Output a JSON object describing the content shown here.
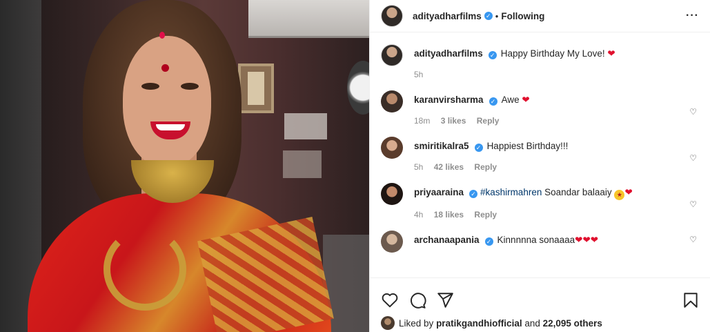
{
  "header": {
    "username": "adityadharfilms",
    "separator": "•",
    "follow_status": "Following",
    "more_icon": "more-horizontal-icon"
  },
  "caption": {
    "username": "adityadharfilms",
    "text": "Happy Birthday My Love!",
    "emoji": "❤",
    "time": "5h"
  },
  "comments": [
    {
      "username": "karanvirsharma",
      "text": "Awe",
      "emoji": "❤",
      "time": "18m",
      "likes": "3 likes",
      "reply": "Reply"
    },
    {
      "username": "smiritikalra5",
      "text": "Happiest Birthday!!!",
      "emoji": "",
      "time": "5h",
      "likes": "42 likes",
      "reply": "Reply"
    },
    {
      "username": "priyaaraina",
      "hashtag": "#kashirmahren",
      "text": "Soandar balaaiy",
      "emoji": "❤",
      "time": "4h",
      "likes": "18 likes",
      "reply": "Reply"
    },
    {
      "username": "archanaapania",
      "text": "Kinnnnna sonaaaa",
      "emoji": "❤❤❤",
      "time": "",
      "likes": "",
      "reply": ""
    }
  ],
  "likes_line": {
    "prefix": "Liked by",
    "user": "pratikgandhiofficial",
    "middle": "and",
    "count": "22,095 others"
  },
  "colors": {
    "verified": "#3897f0",
    "heart": "#e0102e",
    "hashtag": "#00376b",
    "muted": "#8e8e8e"
  }
}
